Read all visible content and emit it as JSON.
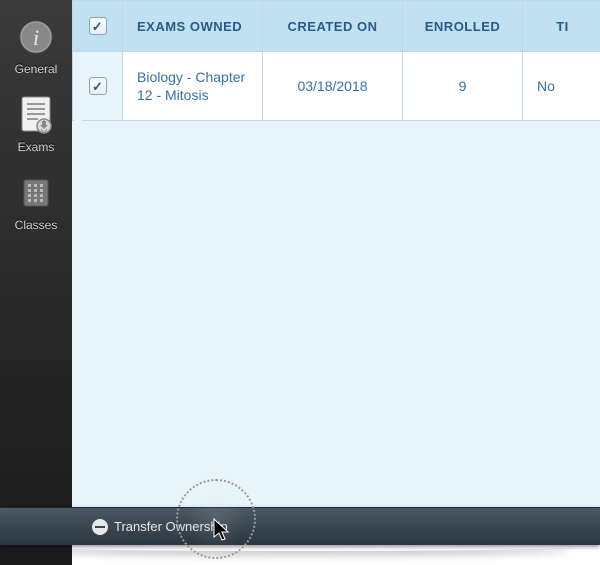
{
  "sidebar": {
    "items": [
      {
        "key": "general",
        "label": "General"
      },
      {
        "key": "exams",
        "label": "Exams"
      },
      {
        "key": "classes",
        "label": "Classes"
      }
    ]
  },
  "table": {
    "headers": {
      "exams_owned": "Exams Owned",
      "created_on": "Created On",
      "enrolled": "Enrolled",
      "last": "Ti"
    },
    "rows": [
      {
        "checked": true,
        "name": "Biology - Chapter 12 - Mitosis",
        "created_on": "03/18/2018",
        "enrolled": "9",
        "last": "No"
      }
    ]
  },
  "toolbar": {
    "transfer_label": "Transfer Ownership"
  }
}
